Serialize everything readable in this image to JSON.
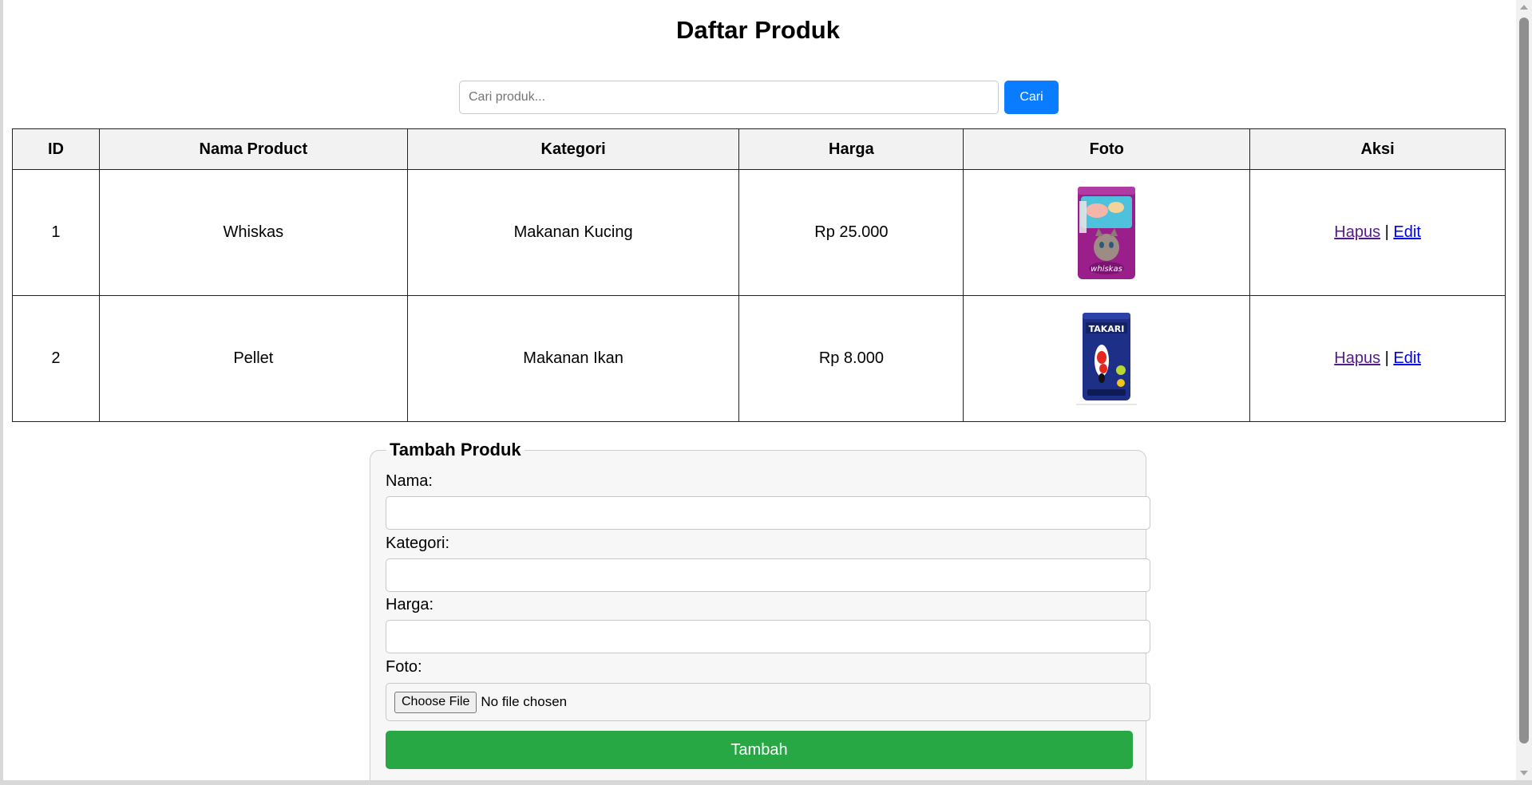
{
  "page": {
    "title": "Daftar Produk"
  },
  "search": {
    "placeholder": "Cari produk...",
    "value": "",
    "button_label": "Cari"
  },
  "table": {
    "headers": [
      "ID",
      "Nama Product",
      "Kategori",
      "Harga",
      "Foto",
      "Aksi"
    ],
    "rows": [
      {
        "id": "1",
        "name": "Whiskas",
        "category": "Makanan Kucing",
        "price": "Rp 25.000",
        "photo_icon": "whiskas-bag-image",
        "actions": {
          "delete": "Hapus",
          "separator": "|",
          "edit": "Edit"
        }
      },
      {
        "id": "2",
        "name": "Pellet",
        "category": "Makanan Ikan",
        "price": "Rp 8.000",
        "photo_icon": "takari-bag-image",
        "actions": {
          "delete": "Hapus",
          "separator": "|",
          "edit": "Edit"
        }
      }
    ]
  },
  "form": {
    "legend": "Tambah Produk",
    "fields": [
      {
        "label": "Nama:",
        "value": ""
      },
      {
        "label": "Kategori:",
        "value": ""
      },
      {
        "label": "Harga:",
        "value": ""
      }
    ],
    "photo": {
      "label": "Foto:",
      "button_label": "Choose File",
      "status": "No file chosen"
    },
    "submit_label": "Tambah"
  },
  "colors": {
    "search_button": "#0a7cff",
    "submit_button": "#28a745",
    "visited_link": "#551a8b",
    "link": "#0000ee",
    "header_bg": "#f2f2f2"
  }
}
